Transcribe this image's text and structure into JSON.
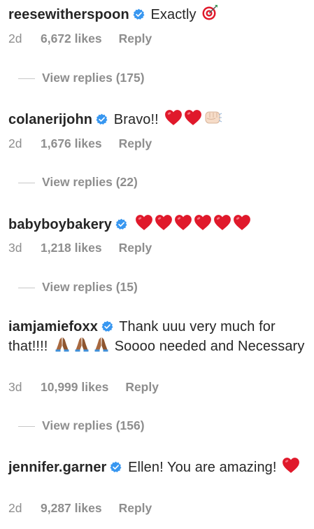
{
  "comments": [
    {
      "username": "reesewitherspoon",
      "text": "Exactly",
      "emojis": [
        "direct-hit"
      ],
      "time": "2d",
      "likes": "6,672 likes",
      "reply_label": "Reply",
      "view_replies": "View replies (175)"
    },
    {
      "username": "colanerijohn",
      "text": "Bravo!!",
      "emojis": [
        "red-heart",
        "red-heart",
        "oncoming-fist"
      ],
      "time": "2d",
      "likes": "1,676 likes",
      "reply_label": "Reply",
      "view_replies": "View replies (22)"
    },
    {
      "username": "babyboybakery",
      "text": "",
      "emojis": [
        "red-heart",
        "red-heart",
        "red-heart",
        "red-heart",
        "red-heart",
        "red-heart"
      ],
      "time": "3d",
      "likes": "1,218 likes",
      "reply_label": "Reply",
      "view_replies": "View replies (15)"
    },
    {
      "username": "iamjamiefoxx",
      "text_part1": "Thank uuu very much for that!!!!",
      "text_part2": "Soooo needed and Necessary",
      "emojis": [
        "folded-hands",
        "folded-hands",
        "folded-hands"
      ],
      "time": "3d",
      "likes": "10,999 likes",
      "reply_label": "Reply",
      "view_replies": "View replies (156)"
    },
    {
      "username": "jennifer.garner",
      "text": "Ellen! You are amazing!",
      "emojis": [
        "red-heart"
      ],
      "time": "2d",
      "likes": "9,287 likes",
      "reply_label": "Reply"
    }
  ],
  "colors": {
    "text": "#262626",
    "meta": "#8e8e8e",
    "verified": "#3897f0",
    "heart": "#e0192b"
  }
}
